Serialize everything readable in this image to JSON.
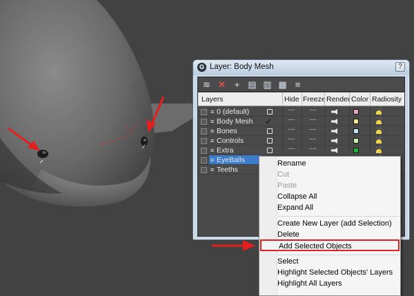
{
  "window": {
    "title": "Layer: Body Mesh",
    "app_icon": "G",
    "help_label": "?"
  },
  "toolbar": {
    "icons": [
      "new-layer-icon",
      "delete-layer-icon",
      "add-to-layer-icon",
      "select-objects-icon",
      "highlight-layer-icon",
      "hide-all-icon",
      "freeze-all-icon"
    ],
    "delete_glyph": "✕",
    "add_glyph": "+"
  },
  "columns": {
    "layers": "Layers",
    "hide": "Hide",
    "freeze": "Freeze",
    "render": "Render",
    "color": "Color",
    "radiosity": "Radiosity"
  },
  "layers": [
    {
      "name": "0 (default)",
      "color": "#e8a2c2"
    },
    {
      "name": "Body Mesh",
      "color": "#f3ea86",
      "active": true
    },
    {
      "name": "Bones",
      "color": "#bfe7f3"
    },
    {
      "name": "Controls",
      "color": "#c8f0a6"
    },
    {
      "name": "Extra",
      "color": "#15b832"
    },
    {
      "name": "EyeBalls",
      "color": "#d83a3a",
      "selected": true
    },
    {
      "name": "Teeths",
      "color": "#d83a3a"
    }
  ],
  "context_menu": {
    "items": [
      {
        "label": "Rename",
        "disabled": false
      },
      {
        "label": "Cut",
        "disabled": true
      },
      {
        "label": "Paste",
        "disabled": true
      },
      {
        "label": "Collapse All",
        "disabled": false
      },
      {
        "label": "Expand All",
        "disabled": false
      },
      {
        "label": "Create New Layer (add Selection)",
        "disabled": false
      },
      {
        "label": "Delete",
        "disabled": false
      },
      {
        "label": "Add Selected Objects",
        "disabled": false,
        "highlighted": true
      },
      {
        "label": "Select",
        "disabled": false
      },
      {
        "label": "Highlight Selected Objects' Layers",
        "disabled": false
      },
      {
        "label": "Highlight All Layers",
        "disabled": false
      }
    ]
  },
  "annotations": {
    "arrow_color": "#e31e1e"
  }
}
